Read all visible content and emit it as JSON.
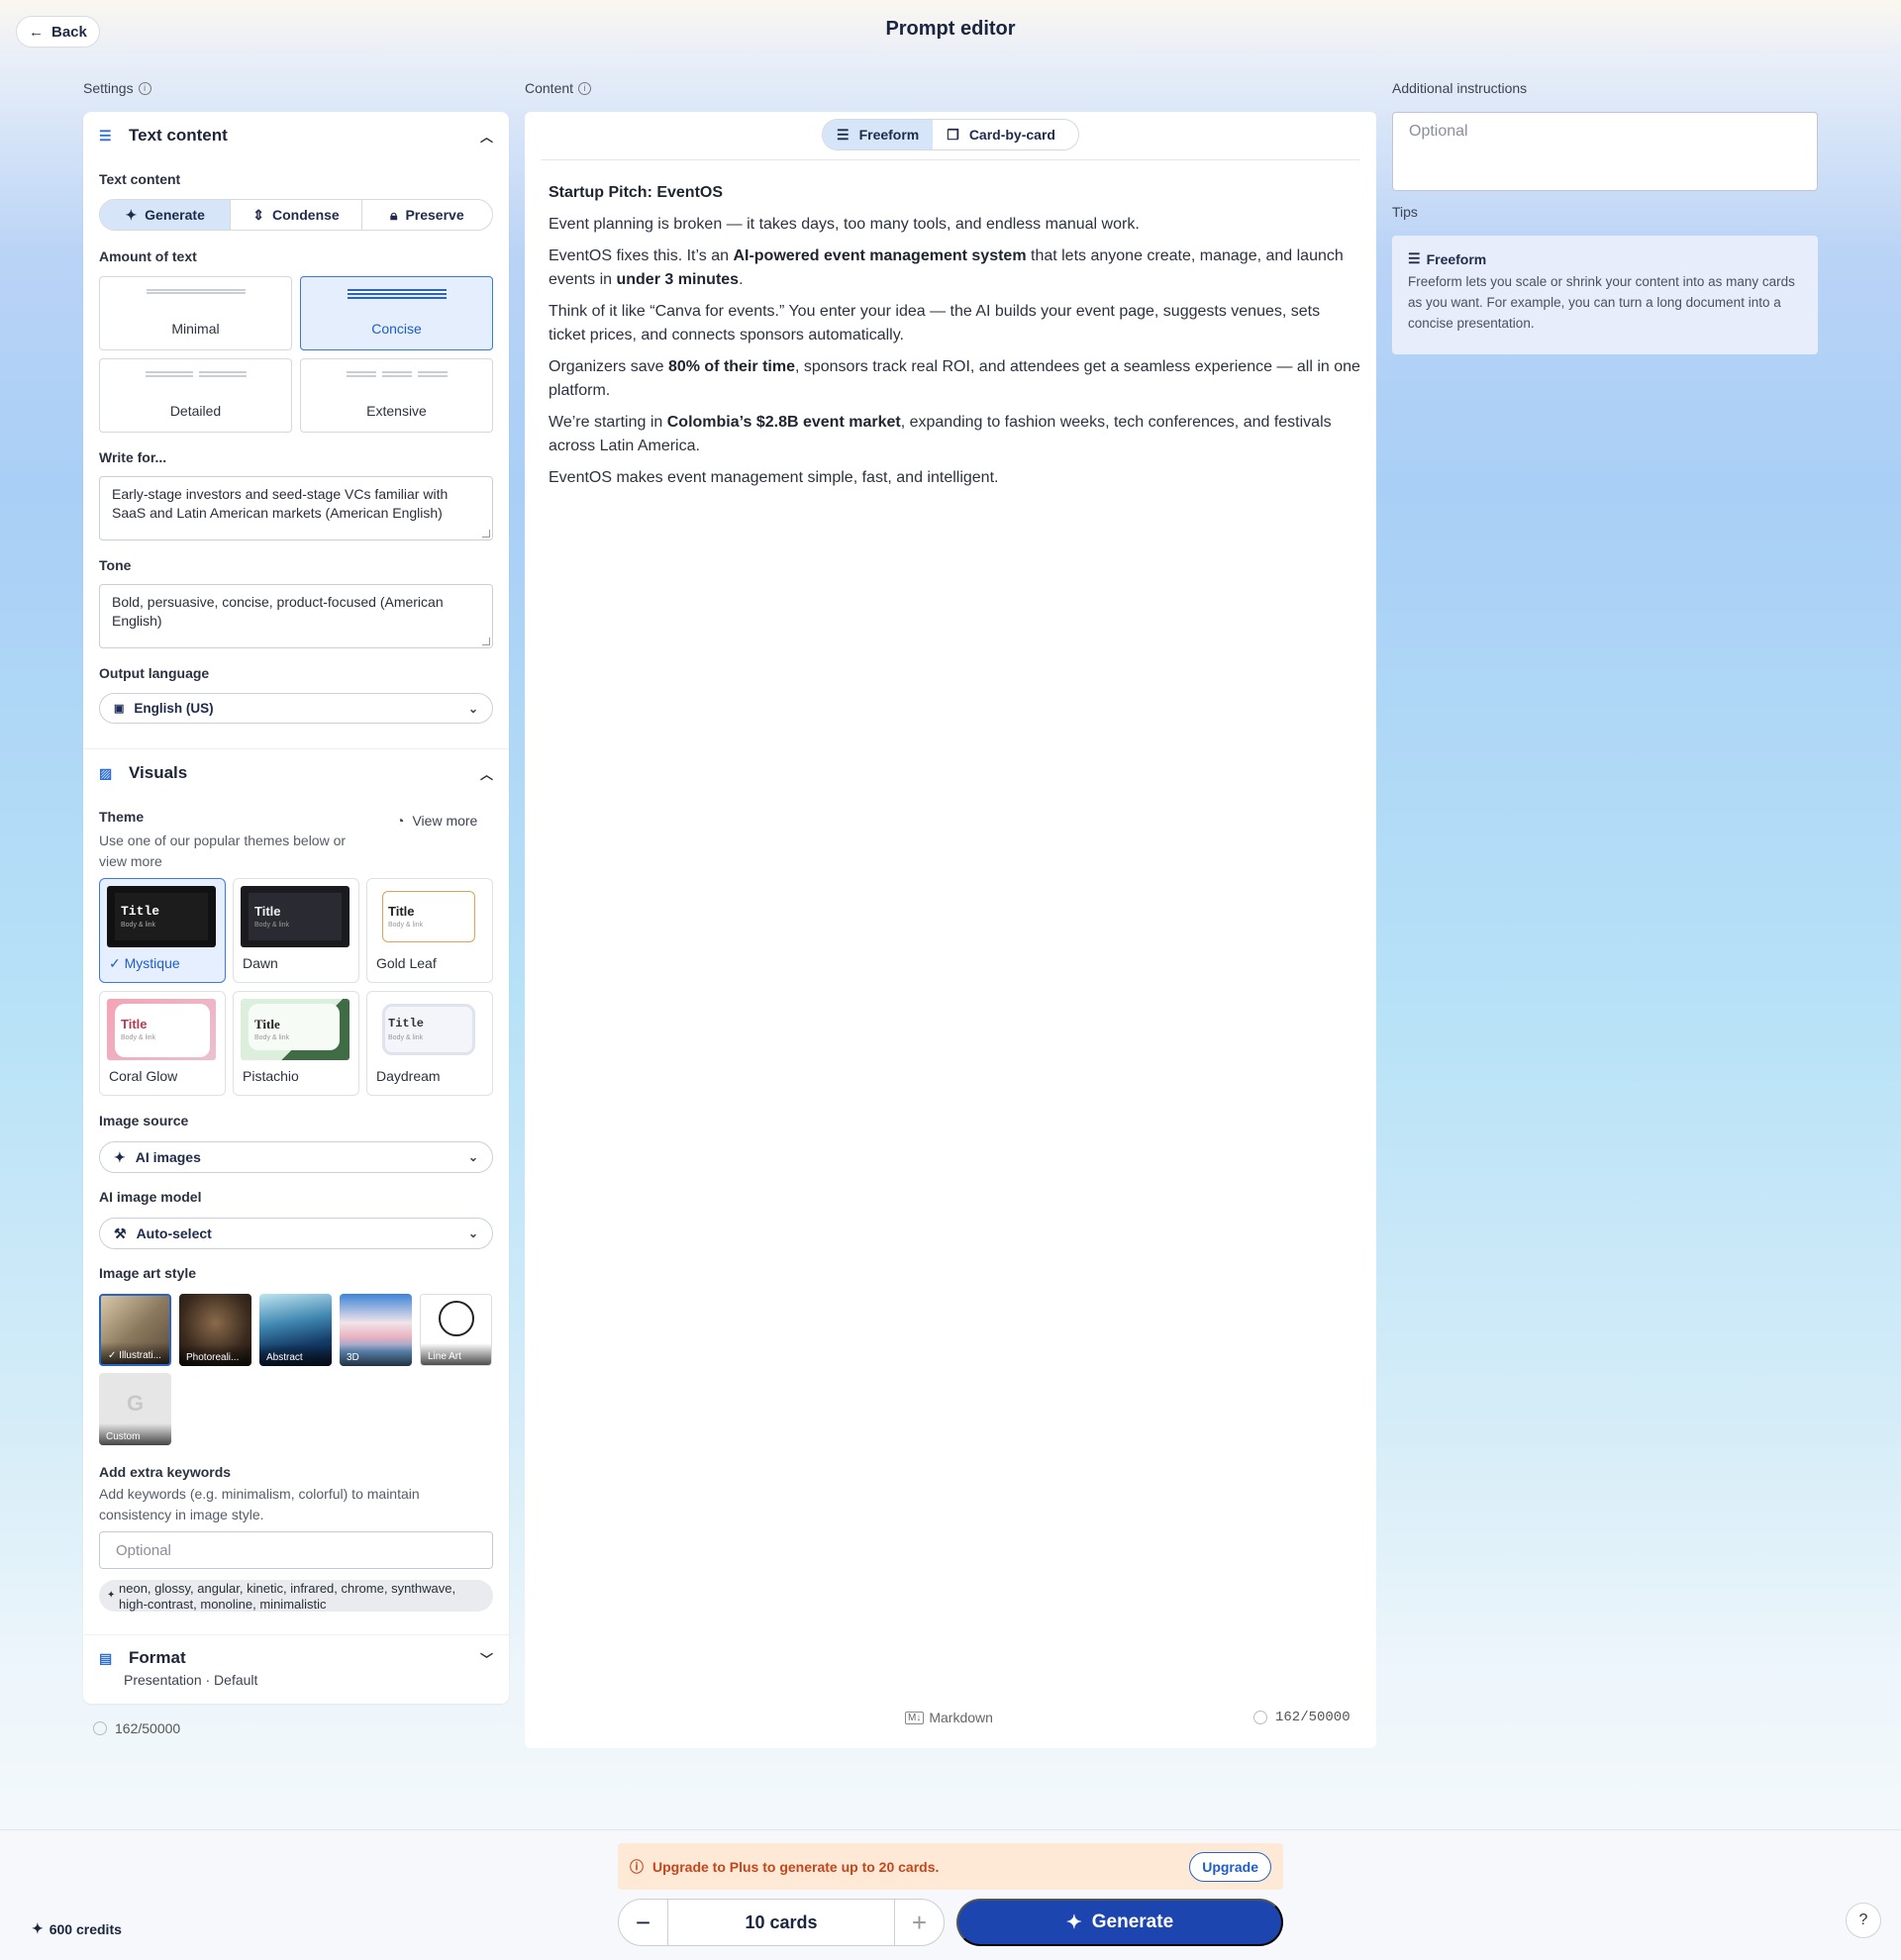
{
  "header": {
    "back_label": "Back",
    "title": "Prompt editor"
  },
  "settings": {
    "label": "Settings",
    "text_content": {
      "section_title": "Text content",
      "field_label": "Text content",
      "modes": [
        "Generate",
        "Condense",
        "Preserve"
      ],
      "selected_mode": "Generate",
      "amount_label": "Amount of text",
      "amounts": [
        "Minimal",
        "Concise",
        "Detailed",
        "Extensive"
      ],
      "selected_amount": "Concise",
      "write_for_label": "Write for...",
      "write_for_value": "Early-stage investors and seed-stage VCs familiar with SaaS and Latin American markets (American English)",
      "tone_label": "Tone",
      "tone_value": "Bold, persuasive, concise, product-focused (American English)",
      "output_language_label": "Output language",
      "output_language_value": "English (US)"
    },
    "visuals": {
      "section_title": "Visuals",
      "theme_label": "Theme",
      "theme_help": "Use one of our popular themes below or view more",
      "view_more": "View more",
      "themes": [
        {
          "name": "Mystique",
          "title": "Title",
          "body": "Body & link"
        },
        {
          "name": "Dawn",
          "title": "Title",
          "body": "Body & link"
        },
        {
          "name": "Gold Leaf",
          "title": "Title",
          "body": "Body & link"
        },
        {
          "name": "Coral Glow",
          "title": "Title",
          "body": "Body & link"
        },
        {
          "name": "Pistachio",
          "title": "Title",
          "body": "Body & link"
        },
        {
          "name": "Daydream",
          "title": "Title",
          "body": "Body & link"
        }
      ],
      "selected_theme": "Mystique",
      "image_source_label": "Image source",
      "image_source_value": "AI images",
      "ai_model_label": "AI image model",
      "ai_model_value": "Auto-select",
      "art_style_label": "Image art style",
      "art_styles": [
        "Illustrati...",
        "Photoreali...",
        "Abstract",
        "3D",
        "Line Art",
        "Custom"
      ],
      "selected_art_style": "Illustrati...",
      "keywords_label": "Add extra keywords",
      "keywords_help": "Add keywords (e.g. minimalism, colorful) to maintain consistency in image style.",
      "keywords_placeholder": "Optional",
      "keywords_suggestion": "neon, glossy, angular, kinetic, infrared, chrome, synthwave, high-contrast, monoline, minimalistic"
    },
    "format": {
      "section_title": "Format",
      "value": "Presentation · Default"
    },
    "char_count": "162/50000"
  },
  "content": {
    "label": "Content",
    "modes": [
      "Freeform",
      "Card-by-card"
    ],
    "selected_mode": "Freeform",
    "doc_title": "Startup Pitch: EventOS",
    "p1": "Event planning is broken — it takes days, too many tools, and endless manual work.",
    "p2_a": "EventOS fixes this. It’s an ",
    "p2_b": "AI-powered event management system",
    "p2_c": " that lets anyone create, manage, and launch events in ",
    "p2_d": "under 3 minutes",
    "p2_e": ".",
    "p3": "Think of it like “Canva for events.” You enter your idea — the AI builds your event page, suggests venues, sets ticket prices, and connects sponsors automatically.",
    "p4_a": "Organizers save ",
    "p4_b": "80% of their time",
    "p4_c": ", sponsors track real ROI, and attendees get a seamless experience — all in one platform.",
    "p5_a": "We’re starting in ",
    "p5_b": "Colombia’s $2.8B event market",
    "p5_c": ", expanding to fashion weeks, tech conferences, and festivals across Latin America.",
    "p6": "EventOS makes event management simple, fast, and intelligent.",
    "markdown_label": "Markdown",
    "char_count": "162/50000"
  },
  "additional": {
    "label": "Additional instructions",
    "placeholder": "Optional",
    "tips_label": "Tips",
    "tip_title": "Freeform",
    "tip_body": "Freeform lets you scale or shrink your content into as many cards as you want. For example, you can turn a long document into a concise presentation."
  },
  "footer": {
    "upsell_text": "Upgrade to Plus to generate up to 20 cards.",
    "upgrade_label": "Upgrade",
    "card_count": "10 cards",
    "generate_label": "Generate",
    "credits": "600 credits",
    "help": "?"
  },
  "colors": {
    "accent": "#1d45b0",
    "selected_bg": "#d7e5f9",
    "upsell_bg": "#fde9d6",
    "upsell_text": "#c4461c"
  }
}
